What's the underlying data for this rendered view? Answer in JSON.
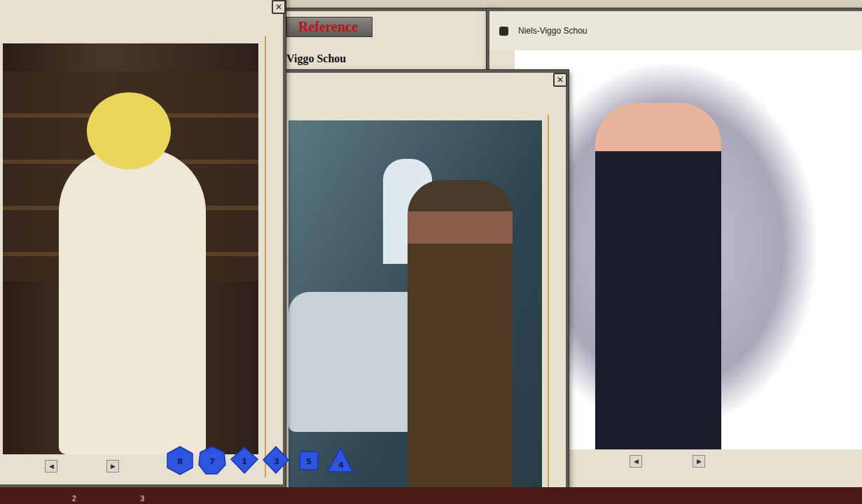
{
  "reference_window": {
    "title": "Reference",
    "heading": "Viggo Schou"
  },
  "left_portrait": {
    "close": "✕",
    "prev": "◀",
    "next": "▶"
  },
  "middle_portrait": {
    "close": "✕"
  },
  "right_window": {
    "title": "Niels-Viggo Schou",
    "prev": "◀",
    "next": "▶"
  },
  "dice": [
    {
      "kind": "d20",
      "face": "8"
    },
    {
      "kind": "d12",
      "face": "7"
    },
    {
      "kind": "d10",
      "face": "1"
    },
    {
      "kind": "d8",
      "face": "3"
    },
    {
      "kind": "d6",
      "face": "5"
    },
    {
      "kind": "d4",
      "face": "4"
    }
  ],
  "hotkeys": [
    "2",
    "3"
  ]
}
